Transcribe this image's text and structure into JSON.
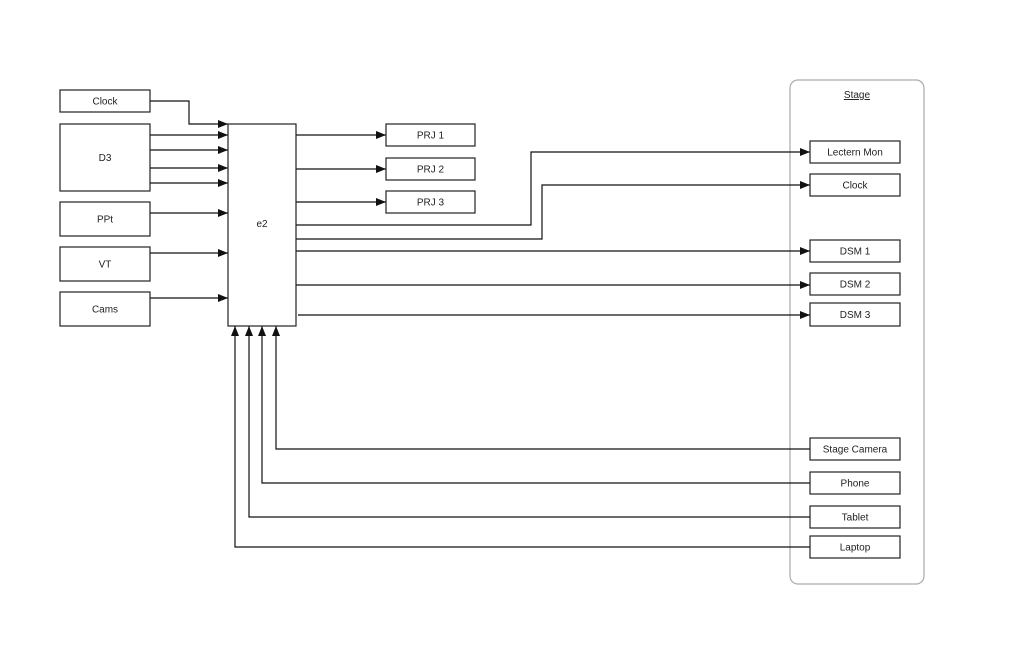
{
  "stage": {
    "title": "Stage"
  },
  "nodes": {
    "clock_src": "Clock",
    "d3": "D3",
    "ppt": "PPt",
    "vt": "VT",
    "cams": "Cams",
    "e2": "e2",
    "prj1": "PRJ 1",
    "prj2": "PRJ 2",
    "prj3": "PRJ 3",
    "lectern": "Lectern Mon",
    "clock_stage": "Clock",
    "dsm1": "DSM 1",
    "dsm2": "DSM 2",
    "dsm3": "DSM 3",
    "stage_camera": "Stage Camera",
    "phone": "Phone",
    "tablet": "Tablet",
    "laptop": "Laptop"
  },
  "edges": [
    [
      "clock_src",
      "e2"
    ],
    [
      "d3",
      "e2"
    ],
    [
      "d3",
      "e2"
    ],
    [
      "d3",
      "e2"
    ],
    [
      "d3",
      "e2"
    ],
    [
      "ppt",
      "e2"
    ],
    [
      "vt",
      "e2"
    ],
    [
      "cams",
      "e2"
    ],
    [
      "e2",
      "prj1"
    ],
    [
      "e2",
      "prj2"
    ],
    [
      "e2",
      "prj3"
    ],
    [
      "e2",
      "lectern"
    ],
    [
      "e2",
      "clock_stage"
    ],
    [
      "e2",
      "dsm1"
    ],
    [
      "e2",
      "dsm2"
    ],
    [
      "e2",
      "dsm3"
    ],
    [
      "stage_camera",
      "e2"
    ],
    [
      "phone",
      "e2"
    ],
    [
      "tablet",
      "e2"
    ],
    [
      "laptop",
      "e2"
    ]
  ]
}
